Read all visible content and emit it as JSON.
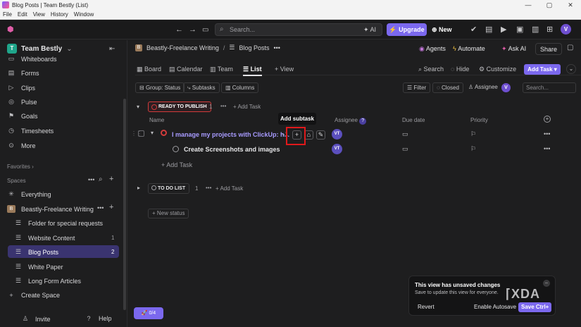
{
  "window": {
    "title": "Blog Posts | Team Bestly (List)",
    "menu": [
      "File",
      "Edit",
      "View",
      "History",
      "Window"
    ],
    "controls": [
      "—",
      "▢",
      "✕"
    ]
  },
  "topbar": {
    "search_placeholder": "Search...",
    "ai_label": "AI",
    "upgrade_label": "Upgrade",
    "new_label": "New",
    "avatar": "V"
  },
  "sidebar": {
    "workspace": "Team Bestly",
    "workspace_badge": "T",
    "items": [
      {
        "label": "Whiteboards",
        "icon": "whiteboard-icon"
      },
      {
        "label": "Forms",
        "icon": "forms-icon"
      },
      {
        "label": "Clips",
        "icon": "clips-icon"
      },
      {
        "label": "Pulse",
        "icon": "pulse-icon"
      },
      {
        "label": "Goals",
        "icon": "goals-icon"
      },
      {
        "label": "Timesheets",
        "icon": "timesheets-icon"
      },
      {
        "label": "More",
        "icon": "more-icon"
      }
    ],
    "favorites_label": "Favorites",
    "spaces_label": "Spaces",
    "everything_label": "Everything",
    "space_name": "Beastly-Freelance Writing",
    "space_badge": "B",
    "folders": [
      {
        "label": "Folder for special requests",
        "count": ""
      },
      {
        "label": "Website Content",
        "count": "1"
      },
      {
        "label": "Blog Posts",
        "count": "2"
      },
      {
        "label": "White Paper",
        "count": ""
      },
      {
        "label": "Long Form Articles",
        "count": ""
      }
    ],
    "create_space": "Create Space",
    "invite": "Invite",
    "help": "Help",
    "fab": "0/4"
  },
  "header": {
    "breadcrumb_space": "Beastly-Freelance Writing",
    "breadcrumb_list": "Blog Posts",
    "breadcrumb_more": "•••",
    "agents": "Agents",
    "automate": "Automate",
    "ask_ai": "Ask AI",
    "share": "Share"
  },
  "views": {
    "tabs": [
      "Board",
      "Calendar",
      "Team",
      "List"
    ],
    "add_view": "View",
    "search": "Search",
    "hide": "Hide",
    "customize": "Customize",
    "add_task": "Add Task"
  },
  "filters": {
    "group": "Group: Status",
    "subtasks": "Subtasks",
    "columns": "Columns",
    "filter": "Filter",
    "closed": "Closed",
    "assignee": "Assignee",
    "assignee_avatar": "V",
    "search_placeholder": "Search..."
  },
  "list": {
    "group1": {
      "label": "READY TO PUBLISH",
      "count": "1",
      "more": "•••",
      "add_task": "Add Task"
    },
    "columns": {
      "name": "Name",
      "assignee": "Assignee",
      "due": "Due date",
      "priority": "Priority"
    },
    "tooltip": "Add subtask",
    "task": {
      "title": "I manage my projects with ClickUp: h...",
      "subtask_count": "1",
      "assignee": "VT"
    },
    "subtask": {
      "title": "Create Screenshots and images",
      "assignee": "VT"
    },
    "add_task": "Add Task",
    "group2": {
      "label": "TO DO LIST",
      "count": "1",
      "add_task": "Add Task"
    },
    "new_status": "New status"
  },
  "toast": {
    "title": "This view has unsaved changes",
    "body": "Save to update this view for everyone.",
    "revert": "Revert",
    "enable_autosave": "Enable Autosave",
    "save": "Save Ctrl+"
  },
  "watermark": "XDA",
  "colors": {
    "accent": "#7b68ee",
    "ready_status": "#d23b3b",
    "highlight": "#e0191b",
    "background": "#1e1e1f"
  }
}
